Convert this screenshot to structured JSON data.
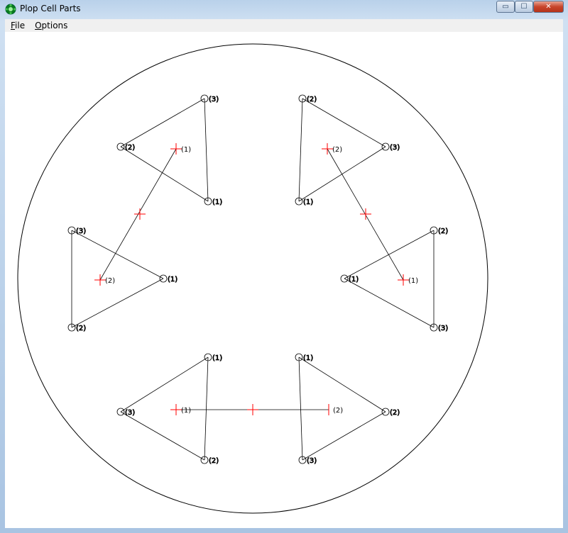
{
  "window": {
    "title": "Plop Cell Parts",
    "colors": {
      "accent": "#ff0000",
      "line": "#000000",
      "canvas": "#ffffff"
    }
  },
  "menu": {
    "file": {
      "u": "F",
      "rest": "ile"
    },
    "options": {
      "u": "O",
      "rest": "ptions"
    }
  },
  "titlebar_buttons": {
    "minimize": "▭",
    "maximize": "☐",
    "close": "✕"
  },
  "icons": {
    "app": "green-gear-icon"
  },
  "labels": [
    "(1)",
    "(2)",
    "(3)"
  ]
}
